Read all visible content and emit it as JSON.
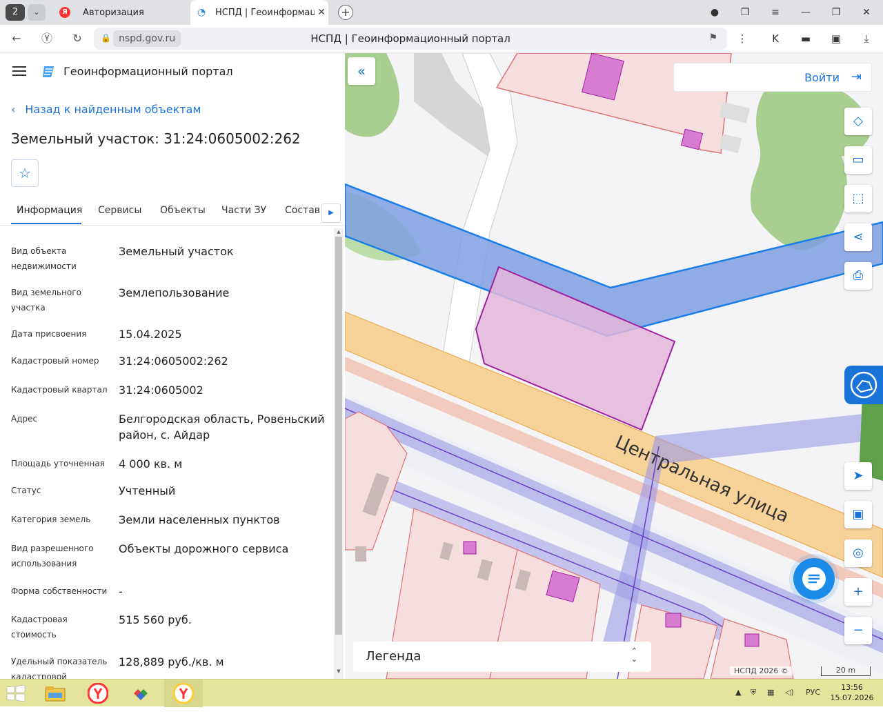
{
  "browser": {
    "tab_count": "2",
    "tabs": [
      {
        "title": "Авторизация"
      },
      {
        "title": "НСПД | Геоинформаци"
      }
    ],
    "url_domain": "nspd.gov.ru",
    "page_title": "НСПД | Геоинформационный портал"
  },
  "panel": {
    "portal_title": "Геоинформационный портал",
    "back_link": "Назад к найденным объектам",
    "object_title": "Земельный участок: 31:24:0605002:262",
    "tabs": [
      {
        "label": "Информация",
        "active": true
      },
      {
        "label": "Сервисы"
      },
      {
        "label": "Объекты"
      },
      {
        "label": "Части ЗУ"
      },
      {
        "label": "Состав"
      }
    ],
    "fields": [
      {
        "label": "Вид объекта недвижимости",
        "value": "Земельный участок"
      },
      {
        "label": "Вид земельного участка",
        "value": "Землепользование"
      },
      {
        "label": "Дата присвоения",
        "value": "15.04.2025"
      },
      {
        "label": "Кадастровый номер",
        "value": "31:24:0605002:262"
      },
      {
        "label": "Кадастровый квартал",
        "value": "31:24:0605002"
      },
      {
        "label": "Адрес",
        "value": "Белгородская область, Ровеньский район, с. Айдар"
      },
      {
        "label": "Площадь уточненная",
        "value": "4 000 кв. м"
      },
      {
        "label": "Статус",
        "value": "Учтенный"
      },
      {
        "label": "Категория земель",
        "value": "Земли населенных пунктов"
      },
      {
        "label": "Вид разрешенного использования",
        "value": "Объекты дорожного сервиса"
      },
      {
        "label": "Форма собственности",
        "value": "-"
      },
      {
        "label": "Кадастровая стоимость",
        "value": "515 560 руб."
      },
      {
        "label": "Удельный показатель кадастровой",
        "value": "128,889 руб./кв. м"
      }
    ]
  },
  "map": {
    "login_label": "Войти",
    "street_label": "Центральная улица",
    "legend_label": "Легенда",
    "copyright": "НСПД 2026 ©",
    "scale_label": "20 m",
    "tools": [
      "layers-icon",
      "ruler-icon",
      "area-search-icon",
      "share-icon",
      "print-icon"
    ],
    "nav_tools": [
      "locate-icon",
      "minimap-icon",
      "geo-search-icon",
      "zoom-in-icon",
      "zoom-out-icon"
    ],
    "colors": {
      "accent": "#1a73d9",
      "parcel_fill": "#e4b6da",
      "parcel_stroke": "#a020a0",
      "zone_blue": "#7f9fe0",
      "road": "#f7d39a"
    }
  },
  "taskbar": {
    "lang": "РУС",
    "time": "13:56",
    "date": "15.07.2026"
  }
}
